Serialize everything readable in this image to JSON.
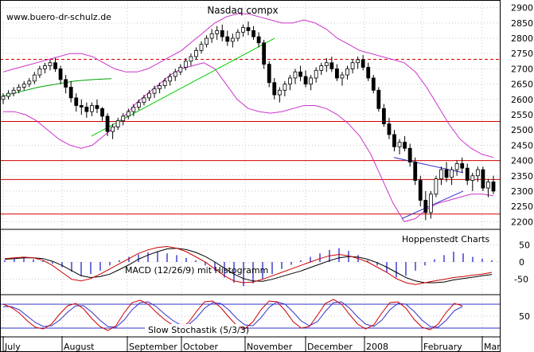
{
  "chart_data": {
    "type": "candlestick",
    "title": "Nasdaq compx",
    "watermark": "www.buero-dr-schulz.de",
    "source_label": "Hoppenstedt Charts",
    "x_axis": {
      "labels": [
        "July",
        "August",
        "September",
        "October",
        "November",
        "December",
        "2008",
        "February",
        "Mar"
      ]
    },
    "price_panel": {
      "ylim": [
        2180,
        2920
      ],
      "ticks": [
        2200,
        2250,
        2300,
        2350,
        2400,
        2450,
        2500,
        2550,
        2600,
        2650,
        2700,
        2750,
        2800,
        2850,
        2900
      ],
      "horizontal_lines": [
        {
          "value": 2528,
          "style": "solid",
          "color": "#d40000"
        },
        {
          "value": 2400,
          "style": "solid",
          "color": "#d40000"
        },
        {
          "value": 2338,
          "style": "solid",
          "color": "#d40000"
        },
        {
          "value": 2225,
          "style": "solid",
          "color": "#d40000"
        },
        {
          "value": 2731,
          "style": "dashed",
          "color": "#d40000"
        }
      ],
      "series": {
        "candles_ohlc": [
          [
            2600,
            2620,
            2585,
            2610
          ],
          [
            2610,
            2630,
            2600,
            2620
          ],
          [
            2620,
            2640,
            2610,
            2630
          ],
          [
            2630,
            2650,
            2620,
            2640
          ],
          [
            2640,
            2660,
            2630,
            2650
          ],
          [
            2650,
            2670,
            2640,
            2660
          ],
          [
            2660,
            2690,
            2650,
            2680
          ],
          [
            2680,
            2710,
            2670,
            2700
          ],
          [
            2700,
            2720,
            2685,
            2710
          ],
          [
            2710,
            2730,
            2695,
            2720
          ],
          [
            2720,
            2735,
            2690,
            2700
          ],
          [
            2700,
            2710,
            2650,
            2665
          ],
          [
            2665,
            2680,
            2620,
            2640
          ],
          [
            2640,
            2660,
            2590,
            2605
          ],
          [
            2605,
            2620,
            2560,
            2580
          ],
          [
            2580,
            2600,
            2550,
            2575
          ],
          [
            2575,
            2590,
            2540,
            2560
          ],
          [
            2560,
            2590,
            2545,
            2580
          ],
          [
            2580,
            2600,
            2555,
            2570
          ],
          [
            2570,
            2575,
            2530,
            2545
          ],
          [
            2545,
            2555,
            2480,
            2495
          ],
          [
            2495,
            2520,
            2470,
            2510
          ],
          [
            2510,
            2540,
            2500,
            2530
          ],
          [
            2530,
            2555,
            2515,
            2545
          ],
          [
            2545,
            2570,
            2535,
            2560
          ],
          [
            2560,
            2585,
            2545,
            2575
          ],
          [
            2575,
            2600,
            2565,
            2590
          ],
          [
            2590,
            2615,
            2580,
            2605
          ],
          [
            2605,
            2630,
            2595,
            2620
          ],
          [
            2620,
            2645,
            2605,
            2635
          ],
          [
            2635,
            2655,
            2620,
            2645
          ],
          [
            2645,
            2670,
            2635,
            2660
          ],
          [
            2660,
            2685,
            2645,
            2675
          ],
          [
            2675,
            2700,
            2660,
            2690
          ],
          [
            2690,
            2715,
            2680,
            2705
          ],
          [
            2705,
            2735,
            2695,
            2725
          ],
          [
            2725,
            2750,
            2710,
            2740
          ],
          [
            2740,
            2770,
            2730,
            2760
          ],
          [
            2760,
            2790,
            2750,
            2780
          ],
          [
            2780,
            2810,
            2770,
            2800
          ],
          [
            2800,
            2830,
            2785,
            2815
          ],
          [
            2815,
            2840,
            2795,
            2825
          ],
          [
            2825,
            2845,
            2790,
            2805
          ],
          [
            2805,
            2825,
            2775,
            2790
          ],
          [
            2790,
            2815,
            2770,
            2800
          ],
          [
            2800,
            2830,
            2790,
            2820
          ],
          [
            2820,
            2845,
            2805,
            2835
          ],
          [
            2835,
            2855,
            2810,
            2825
          ],
          [
            2825,
            2840,
            2795,
            2805
          ],
          [
            2805,
            2820,
            2770,
            2785
          ],
          [
            2785,
            2795,
            2700,
            2715
          ],
          [
            2715,
            2725,
            2640,
            2655
          ],
          [
            2655,
            2670,
            2600,
            2615
          ],
          [
            2615,
            2640,
            2590,
            2630
          ],
          [
            2630,
            2660,
            2610,
            2650
          ],
          [
            2650,
            2680,
            2630,
            2670
          ],
          [
            2670,
            2700,
            2650,
            2690
          ],
          [
            2690,
            2710,
            2660,
            2675
          ],
          [
            2675,
            2695,
            2640,
            2650
          ],
          [
            2650,
            2680,
            2630,
            2670
          ],
          [
            2670,
            2705,
            2655,
            2695
          ],
          [
            2695,
            2720,
            2680,
            2710
          ],
          [
            2710,
            2735,
            2690,
            2720
          ],
          [
            2720,
            2740,
            2690,
            2700
          ],
          [
            2700,
            2715,
            2660,
            2670
          ],
          [
            2670,
            2690,
            2645,
            2680
          ],
          [
            2680,
            2710,
            2665,
            2700
          ],
          [
            2700,
            2730,
            2685,
            2720
          ],
          [
            2720,
            2740,
            2700,
            2730
          ],
          [
            2730,
            2745,
            2695,
            2705
          ],
          [
            2705,
            2720,
            2660,
            2670
          ],
          [
            2670,
            2680,
            2620,
            2630
          ],
          [
            2630,
            2640,
            2560,
            2570
          ],
          [
            2570,
            2585,
            2510,
            2520
          ],
          [
            2520,
            2540,
            2470,
            2485
          ],
          [
            2485,
            2500,
            2430,
            2445
          ],
          [
            2445,
            2470,
            2420,
            2460
          ],
          [
            2460,
            2480,
            2430,
            2440
          ],
          [
            2440,
            2455,
            2380,
            2395
          ],
          [
            2395,
            2410,
            2320,
            2335
          ],
          [
            2335,
            2350,
            2250,
            2270
          ],
          [
            2270,
            2300,
            2205,
            2230
          ],
          [
            2230,
            2300,
            2210,
            2290
          ],
          [
            2290,
            2350,
            2280,
            2340
          ],
          [
            2340,
            2380,
            2320,
            2370
          ],
          [
            2370,
            2395,
            2330,
            2345
          ],
          [
            2345,
            2380,
            2320,
            2370
          ],
          [
            2370,
            2400,
            2350,
            2390
          ],
          [
            2390,
            2410,
            2360,
            2375
          ],
          [
            2375,
            2390,
            2320,
            2335
          ],
          [
            2335,
            2360,
            2300,
            2350
          ],
          [
            2350,
            2380,
            2330,
            2370
          ],
          [
            2370,
            2380,
            2300,
            2310
          ],
          [
            2310,
            2340,
            2280,
            2330
          ],
          [
            2330,
            2350,
            2290,
            2300
          ]
        ],
        "bollinger_upper": [
          2690,
          2700,
          2710,
          2720,
          2730,
          2740,
          2750,
          2750,
          2740,
          2720,
          2700,
          2690,
          2690,
          2700,
          2720,
          2740,
          2760,
          2790,
          2820,
          2850,
          2870,
          2880,
          2880,
          2870,
          2860,
          2850,
          2850,
          2860,
          2850,
          2830,
          2800,
          2780,
          2760,
          2750,
          2740,
          2730,
          2720,
          2690,
          2640,
          2580,
          2520,
          2470,
          2440,
          2420,
          2410
        ],
        "bollinger_lower": [
          2560,
          2560,
          2550,
          2530,
          2500,
          2470,
          2450,
          2440,
          2450,
          2480,
          2510,
          2550,
          2590,
          2620,
          2650,
          2680,
          2700,
          2710,
          2720,
          2700,
          2650,
          2600,
          2570,
          2560,
          2555,
          2560,
          2570,
          2580,
          2580,
          2570,
          2550,
          2520,
          2480,
          2420,
          2340,
          2260,
          2200,
          2210,
          2240,
          2260,
          2270,
          2280,
          2290,
          2290,
          2285
        ],
        "sma_green_long": [
          2610,
          2625,
          2640,
          2650,
          2660,
          2665,
          2668
        ],
        "trendline_green": {
          "from": 2480,
          "to": 2800
        },
        "trendline_blue_upper": {
          "from": 2410,
          "to": 2360
        },
        "trendline_blue_lower": {
          "from": 2210,
          "to": 2300
        }
      }
    },
    "macd_panel": {
      "label": "MACD (12/26/9) mit Histogramm",
      "ylim": [
        -90,
        90
      ],
      "ticks": [
        50,
        0,
        -50
      ],
      "series": {
        "histogram": [
          5,
          10,
          12,
          8,
          4,
          -5,
          -15,
          -28,
          -40,
          -35,
          -25,
          -10,
          5,
          15,
          22,
          28,
          30,
          25,
          20,
          12,
          5,
          -10,
          -25,
          -45,
          -60,
          -70,
          -62,
          -50,
          -35,
          -20,
          -8,
          5,
          15,
          25,
          35,
          40,
          32,
          20,
          5,
          -10,
          -30,
          -45,
          -40,
          -25,
          -10,
          8,
          20,
          30,
          25,
          15,
          10,
          5
        ],
        "macd_red": [
          10,
          12,
          14,
          12,
          5,
          -10,
          -30,
          -50,
          -55,
          -48,
          -35,
          -20,
          -5,
          10,
          25,
          35,
          42,
          45,
          40,
          30,
          15,
          0,
          -20,
          -40,
          -55,
          -60,
          -58,
          -50,
          -40,
          -30,
          -20,
          -10,
          0,
          10,
          18,
          22,
          18,
          10,
          0,
          -15,
          -30,
          -48,
          -60,
          -65,
          -60,
          -55,
          -50,
          -45,
          -42,
          -38,
          -35,
          -30
        ],
        "signal_black": [
          8,
          10,
          12,
          12,
          10,
          2,
          -10,
          -25,
          -40,
          -45,
          -42,
          -35,
          -22,
          -8,
          8,
          20,
          30,
          38,
          40,
          36,
          28,
          16,
          0,
          -18,
          -35,
          -48,
          -55,
          -56,
          -50,
          -42,
          -34,
          -26,
          -16,
          -6,
          4,
          12,
          16,
          14,
          8,
          -2,
          -15,
          -30,
          -45,
          -55,
          -60,
          -60,
          -58,
          -52,
          -48,
          -44,
          -40,
          -36
        ]
      }
    },
    "stochastic_panel": {
      "label": "Slow Stochastik (5/3/3)",
      "ylim": [
        0,
        100
      ],
      "ticks": [
        50
      ],
      "reference_lines": [
        80,
        20
      ],
      "series": {
        "k_red": [
          80,
          72,
          58,
          38,
          22,
          18,
          30,
          55,
          76,
          82,
          68,
          44,
          24,
          14,
          26,
          58,
          84,
          90,
          80,
          60,
          42,
          28,
          20,
          34,
          62,
          86,
          88,
          72,
          48,
          26,
          18,
          36,
          66,
          88,
          86,
          64,
          36,
          20,
          24,
          52,
          82,
          92,
          80,
          54,
          30,
          18,
          28,
          58,
          84,
          86,
          70,
          42,
          22,
          16,
          30,
          60,
          82,
          76
        ],
        "d_blue": [
          74,
          74,
          66,
          50,
          34,
          24,
          26,
          40,
          60,
          76,
          76,
          60,
          40,
          24,
          22,
          40,
          66,
          84,
          86,
          74,
          56,
          40,
          28,
          28,
          46,
          70,
          84,
          82,
          66,
          44,
          28,
          26,
          46,
          72,
          86,
          80,
          60,
          38,
          26,
          36,
          62,
          84,
          86,
          70,
          48,
          30,
          24,
          40,
          66,
          82,
          80,
          62,
          40,
          24,
          22,
          40,
          64,
          74
        ]
      }
    }
  }
}
